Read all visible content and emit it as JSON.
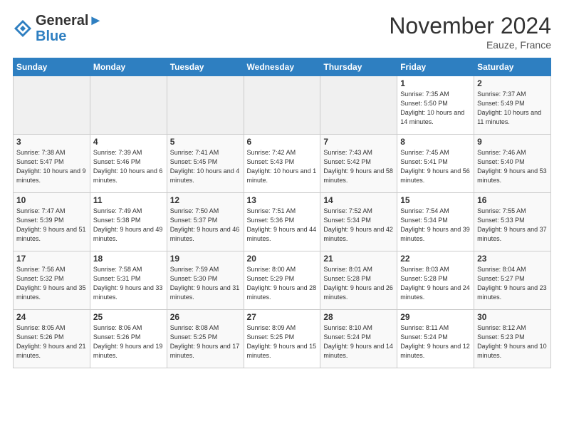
{
  "header": {
    "logo_line1": "General",
    "logo_line2": "Blue",
    "title": "November 2024",
    "location": "Eauze, France"
  },
  "days_of_week": [
    "Sunday",
    "Monday",
    "Tuesday",
    "Wednesday",
    "Thursday",
    "Friday",
    "Saturday"
  ],
  "weeks": [
    [
      {
        "num": "",
        "info": ""
      },
      {
        "num": "",
        "info": ""
      },
      {
        "num": "",
        "info": ""
      },
      {
        "num": "",
        "info": ""
      },
      {
        "num": "",
        "info": ""
      },
      {
        "num": "1",
        "info": "Sunrise: 7:35 AM\nSunset: 5:50 PM\nDaylight: 10 hours and 14 minutes."
      },
      {
        "num": "2",
        "info": "Sunrise: 7:37 AM\nSunset: 5:49 PM\nDaylight: 10 hours and 11 minutes."
      }
    ],
    [
      {
        "num": "3",
        "info": "Sunrise: 7:38 AM\nSunset: 5:47 PM\nDaylight: 10 hours and 9 minutes."
      },
      {
        "num": "4",
        "info": "Sunrise: 7:39 AM\nSunset: 5:46 PM\nDaylight: 10 hours and 6 minutes."
      },
      {
        "num": "5",
        "info": "Sunrise: 7:41 AM\nSunset: 5:45 PM\nDaylight: 10 hours and 4 minutes."
      },
      {
        "num": "6",
        "info": "Sunrise: 7:42 AM\nSunset: 5:43 PM\nDaylight: 10 hours and 1 minute."
      },
      {
        "num": "7",
        "info": "Sunrise: 7:43 AM\nSunset: 5:42 PM\nDaylight: 9 hours and 58 minutes."
      },
      {
        "num": "8",
        "info": "Sunrise: 7:45 AM\nSunset: 5:41 PM\nDaylight: 9 hours and 56 minutes."
      },
      {
        "num": "9",
        "info": "Sunrise: 7:46 AM\nSunset: 5:40 PM\nDaylight: 9 hours and 53 minutes."
      }
    ],
    [
      {
        "num": "10",
        "info": "Sunrise: 7:47 AM\nSunset: 5:39 PM\nDaylight: 9 hours and 51 minutes."
      },
      {
        "num": "11",
        "info": "Sunrise: 7:49 AM\nSunset: 5:38 PM\nDaylight: 9 hours and 49 minutes."
      },
      {
        "num": "12",
        "info": "Sunrise: 7:50 AM\nSunset: 5:37 PM\nDaylight: 9 hours and 46 minutes."
      },
      {
        "num": "13",
        "info": "Sunrise: 7:51 AM\nSunset: 5:36 PM\nDaylight: 9 hours and 44 minutes."
      },
      {
        "num": "14",
        "info": "Sunrise: 7:52 AM\nSunset: 5:34 PM\nDaylight: 9 hours and 42 minutes."
      },
      {
        "num": "15",
        "info": "Sunrise: 7:54 AM\nSunset: 5:34 PM\nDaylight: 9 hours and 39 minutes."
      },
      {
        "num": "16",
        "info": "Sunrise: 7:55 AM\nSunset: 5:33 PM\nDaylight: 9 hours and 37 minutes."
      }
    ],
    [
      {
        "num": "17",
        "info": "Sunrise: 7:56 AM\nSunset: 5:32 PM\nDaylight: 9 hours and 35 minutes."
      },
      {
        "num": "18",
        "info": "Sunrise: 7:58 AM\nSunset: 5:31 PM\nDaylight: 9 hours and 33 minutes."
      },
      {
        "num": "19",
        "info": "Sunrise: 7:59 AM\nSunset: 5:30 PM\nDaylight: 9 hours and 31 minutes."
      },
      {
        "num": "20",
        "info": "Sunrise: 8:00 AM\nSunset: 5:29 PM\nDaylight: 9 hours and 28 minutes."
      },
      {
        "num": "21",
        "info": "Sunrise: 8:01 AM\nSunset: 5:28 PM\nDaylight: 9 hours and 26 minutes."
      },
      {
        "num": "22",
        "info": "Sunrise: 8:03 AM\nSunset: 5:28 PM\nDaylight: 9 hours and 24 minutes."
      },
      {
        "num": "23",
        "info": "Sunrise: 8:04 AM\nSunset: 5:27 PM\nDaylight: 9 hours and 23 minutes."
      }
    ],
    [
      {
        "num": "24",
        "info": "Sunrise: 8:05 AM\nSunset: 5:26 PM\nDaylight: 9 hours and 21 minutes."
      },
      {
        "num": "25",
        "info": "Sunrise: 8:06 AM\nSunset: 5:26 PM\nDaylight: 9 hours and 19 minutes."
      },
      {
        "num": "26",
        "info": "Sunrise: 8:08 AM\nSunset: 5:25 PM\nDaylight: 9 hours and 17 minutes."
      },
      {
        "num": "27",
        "info": "Sunrise: 8:09 AM\nSunset: 5:25 PM\nDaylight: 9 hours and 15 minutes."
      },
      {
        "num": "28",
        "info": "Sunrise: 8:10 AM\nSunset: 5:24 PM\nDaylight: 9 hours and 14 minutes."
      },
      {
        "num": "29",
        "info": "Sunrise: 8:11 AM\nSunset: 5:24 PM\nDaylight: 9 hours and 12 minutes."
      },
      {
        "num": "30",
        "info": "Sunrise: 8:12 AM\nSunset: 5:23 PM\nDaylight: 9 hours and 10 minutes."
      }
    ]
  ]
}
